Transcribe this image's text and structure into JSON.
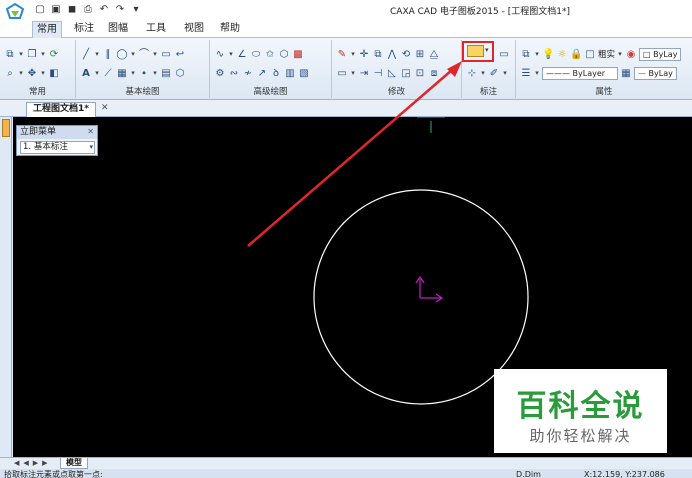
{
  "app": {
    "title": "CAXA CAD 电子图板2015 - [工程图文档1*]"
  },
  "menu_tabs": [
    "常用",
    "标注",
    "图幅",
    "工具",
    "视图",
    "帮助"
  ],
  "ribbon_groups": [
    "常用",
    "基本绘图",
    "高级绘图",
    "修改",
    "标注",
    "属性"
  ],
  "properties": {
    "linewidth_label": "粗实",
    "color_combo": "ByLay",
    "linetype_combo": "ByLayer",
    "lineweight_combo": "ByLay"
  },
  "document": {
    "tab_label": "工程图文档1*"
  },
  "immediate_menu": {
    "title": "立即菜单",
    "option_index": "1.",
    "option_value": "基本标注"
  },
  "layout": {
    "model_tab": "模型"
  },
  "status": {
    "prompt": "拾取标注元素或点取第一点:",
    "command": "D.Dim",
    "coords": "X:12.159, Y:237.086"
  },
  "watermark": {
    "main": "百科全说",
    "sub": "助你轻松解决"
  },
  "colors": {
    "canvas": "#000000",
    "highlight": "#e0262a",
    "circle": "#ffffff",
    "ucs": "#c020c0",
    "watermark_green": "#2a9b3a"
  },
  "icons": [
    "app-logo-icon",
    "new-file-icon",
    "open-file-icon",
    "save-icon",
    "print-icon",
    "undo-icon",
    "redo-icon",
    "dimension-icon",
    "close-icon",
    "dropdown-arrow-icon"
  ]
}
